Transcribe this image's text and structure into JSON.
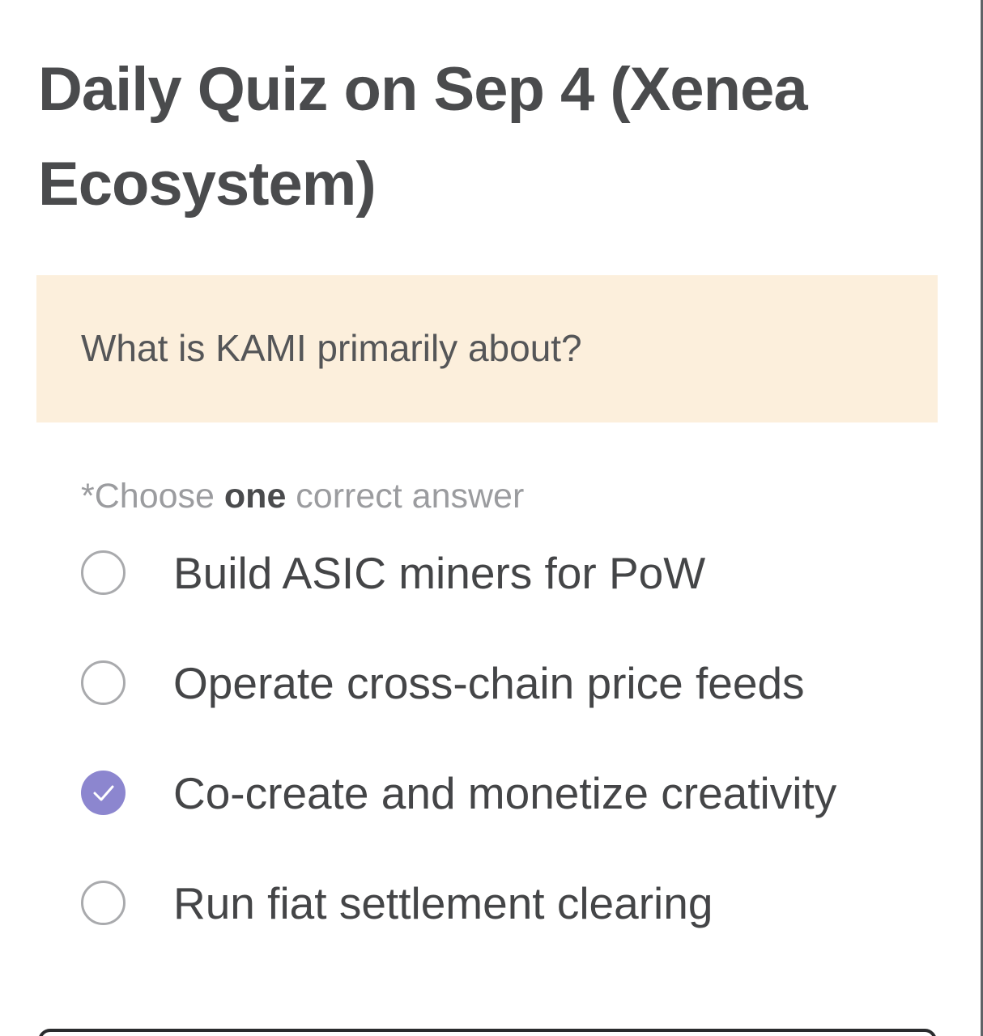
{
  "quiz": {
    "title": "Daily Quiz on Sep 4 (Xenea Ecosystem)",
    "question": "What is KAMI primarily about?",
    "instruction": {
      "prefix": "*Choose ",
      "emphasis": "one",
      "suffix": " correct answer"
    },
    "options": [
      {
        "label": "Build ASIC miners for PoW",
        "selected": false
      },
      {
        "label": "Operate cross-chain price feeds",
        "selected": false
      },
      {
        "label": "Co-create and monetize creativity",
        "selected": true
      },
      {
        "label": "Run fiat settlement clearing",
        "selected": false
      }
    ]
  },
  "colors": {
    "question_background": "#fcefdc",
    "selected_radio": "#8c86cf",
    "title_text": "#4a4b4d",
    "muted_text": "#9b9c9f"
  },
  "icons": {
    "selected_option": "checkmark-icon"
  }
}
